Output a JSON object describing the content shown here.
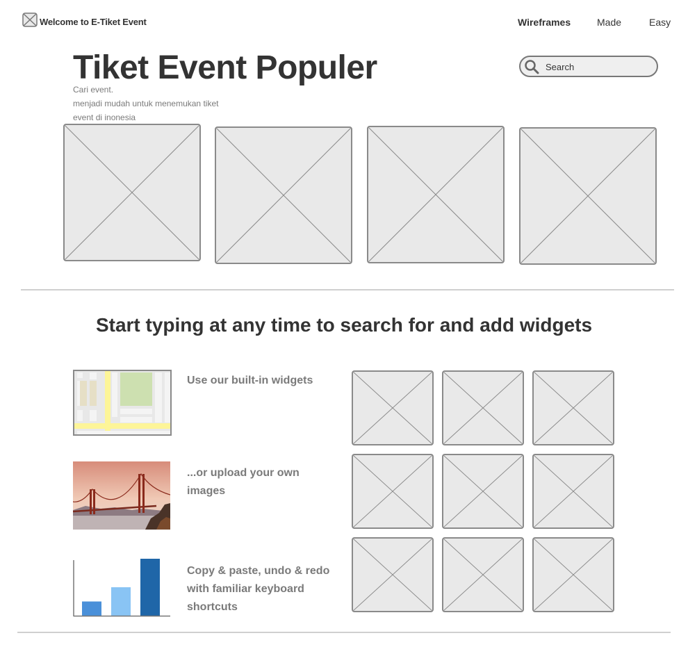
{
  "header": {
    "brand": "Welcome to E-Tiket Event",
    "nav": [
      "Wireframes",
      "Made",
      "Easy"
    ]
  },
  "hero": {
    "title": "Tiket Event Populer",
    "subtitle_lines": [
      "Cari event.",
      "menjadi mudah untuk menemukan tiket",
      "event di inonesia"
    ]
  },
  "search": {
    "placeholder": "Search"
  },
  "section": {
    "title": "Start typing at any time to search for and add widgets"
  },
  "features": [
    {
      "text": "Use our built-in widgets",
      "icon": "map-widget"
    },
    {
      "text": "...or upload your own images",
      "icon": "bridge-photo"
    },
    {
      "text": "Copy & paste, undo & redo with familiar keyboard shortcuts",
      "icon": "bar-chart"
    }
  ],
  "chart_data": {
    "type": "bar",
    "categories": [
      "",
      "",
      ""
    ],
    "values": [
      20,
      40,
      80
    ],
    "colors": [
      "#4a90d9",
      "#89c4f4",
      "#1f66a8"
    ],
    "ylim": [
      0,
      80
    ]
  },
  "colors": {
    "placeholder_fill": "#e9e9e9",
    "placeholder_stroke": "#8a8a8a",
    "divider": "#cfcfcf"
  }
}
